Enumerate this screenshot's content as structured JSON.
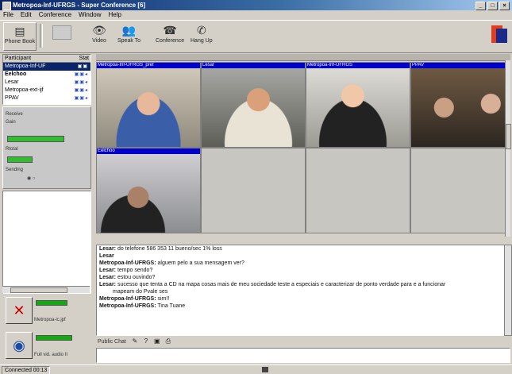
{
  "window": {
    "title": "Metropoa-Inf-UFRGS - Super Conference [6]",
    "controls": [
      "_",
      "□",
      "×"
    ]
  },
  "menu": [
    "File",
    "Edit",
    "Conference",
    "Window",
    "Help"
  ],
  "toolbar": {
    "buttons": [
      {
        "label": "Phone Book",
        "icon": "phone-book-icon"
      },
      {
        "label": "Video",
        "icon": "video-icon"
      },
      {
        "label": "Speak To",
        "icon": "speak-to-icon"
      },
      {
        "label": "Conference",
        "icon": "conference-icon"
      },
      {
        "label": "Hang Up",
        "icon": "hang-up-icon"
      }
    ]
  },
  "participants": {
    "header": [
      "Participant",
      "Stat"
    ],
    "rows": [
      {
        "name": "Metropoa-Inf-UF",
        "selected": true
      },
      {
        "name": "Eelchoo"
      },
      {
        "name": "Lesar"
      },
      {
        "name": "Metropoa-ext-ijf"
      },
      {
        "name": "PPAV"
      }
    ]
  },
  "audio_controls": {
    "labels": [
      "Receive",
      "Gain",
      "Rtotal",
      "Sending"
    ]
  },
  "videos": {
    "tiles": [
      {
        "title": "Metropoa-Inf-UFRGS_pref"
      },
      {
        "title": "Lesar"
      },
      {
        "title": "Metropoa-Inf-UFRGS"
      },
      {
        "title": "PPAV"
      },
      {
        "title": "Eelchoo"
      }
    ]
  },
  "left_status": {
    "mute_label": "Metropoa-ic.jpf",
    "speaker_label": "Full vid. audio II"
  },
  "chat": {
    "lines": [
      {
        "who": "Lesar:",
        "text": "do telefone 586 353 11 bueno/sec 1% loss"
      },
      {
        "who": "Lesar",
        "text": ""
      },
      {
        "who": "Metropoa-Inf-UFRGS:",
        "text": "alguem pelo a sua mensagem ver?"
      },
      {
        "who": "Lesar:",
        "text": "tempo sendo?"
      },
      {
        "who": "Lesar:",
        "text": "estou ouvindo?"
      },
      {
        "who": "Lesar:",
        "text": "sucesso que tenta a CD na mapa cosas mais de meu sociedade teste a especiais e caracterizar de ponto verdade para e a funcionar"
      },
      {
        "who": "",
        "text": "mapeam do Pvale ses",
        "cont": true
      },
      {
        "who": "Metropoa-Inf-UFRGS:",
        "text": "sim!!"
      },
      {
        "who": "Metropoa-Inf-UFRGS:",
        "text": "Tina Tuane"
      }
    ],
    "tab_label": "Public Chat"
  },
  "statusbar": {
    "text": "Connected 00:13"
  }
}
